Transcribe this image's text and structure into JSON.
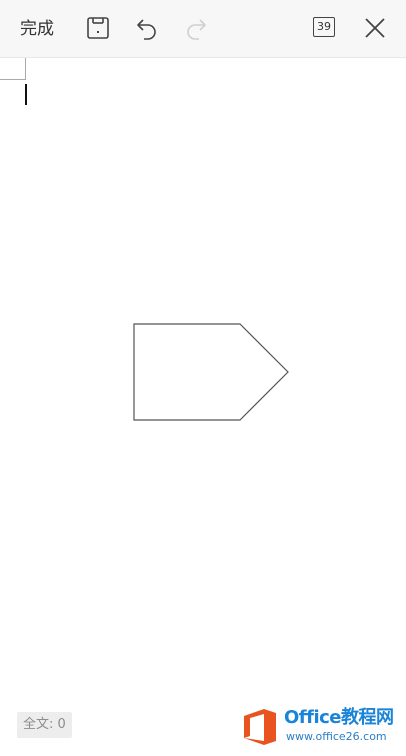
{
  "toolbar": {
    "done_label": "完成",
    "page_count": "39",
    "icons": [
      "save-icon",
      "undo-icon",
      "redo-icon",
      "close-icon"
    ],
    "redo_enabled": false
  },
  "document": {
    "shape": "pentagon-arrow"
  },
  "status": {
    "word_count_label": "全文: 0"
  },
  "watermark": {
    "title": "Office教程网",
    "url": "www.office26.com",
    "logo_color": "#e8531f"
  }
}
